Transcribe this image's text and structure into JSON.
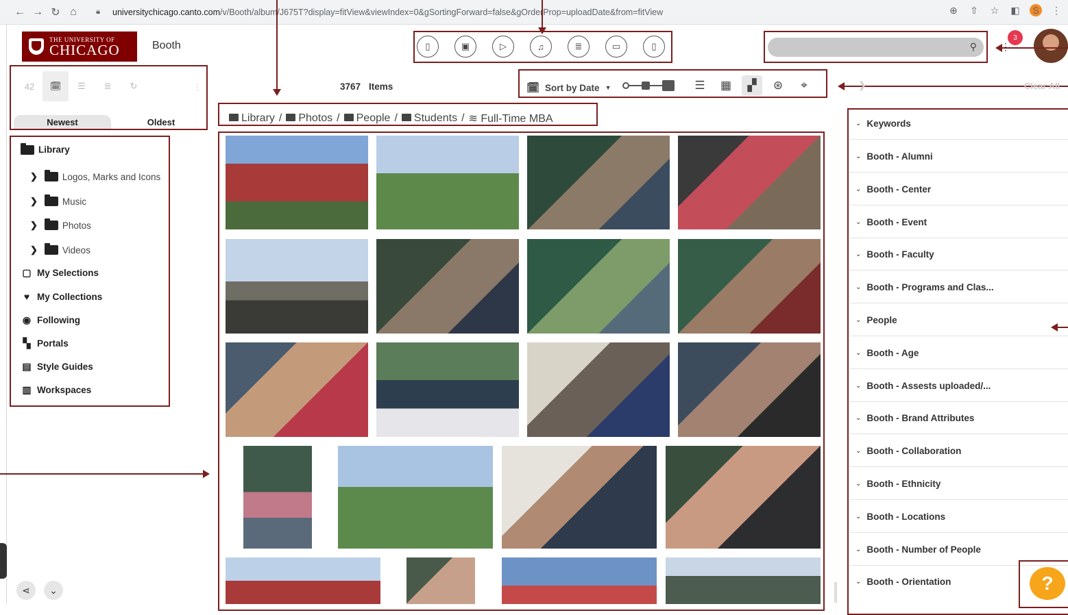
{
  "browser": {
    "url_host": "universitychicago.canto.com",
    "url_path": "/v/Booth/album/J675T?display=fitView&viewIndex=0&gSortingForward=false&gOrderProp=uploadDate&from=fitView",
    "profile_initial": "S"
  },
  "header": {
    "logo_small": "THE UNIVERSITY OF",
    "logo_big": "CHICAGO",
    "brand_label": "Booth",
    "notification_count": "3"
  },
  "sort_panel": {
    "count_label": "42",
    "newest": "Newest",
    "oldest": "Oldest"
  },
  "sidebar": {
    "library": "Library",
    "folders": [
      "Logos, Marks and Icons",
      "Music",
      "Photos",
      "Videos"
    ],
    "my_selections": "My Selections",
    "my_collections": "My Collections",
    "following": "Following",
    "portals": "Portals",
    "style_guides": "Style Guides",
    "workspaces": "Workspaces"
  },
  "toolbar": {
    "item_count": "3767",
    "items_label": "Items",
    "sort_label": "Sort by Date"
  },
  "breadcrumb": {
    "items": [
      "Library",
      "Photos",
      "People",
      "Students",
      "Full-Time MBA"
    ],
    "sep": "/"
  },
  "facets": {
    "clear_all": "Clear All",
    "items": [
      "Keywords",
      "Booth - Alumni",
      "Booth - Center",
      "Booth - Event",
      "Booth - Faculty",
      "Booth - Programs and Clas...",
      "People",
      "Booth - Age",
      "Booth - Assests uploaded/...",
      "Booth - Brand Attributes",
      "Booth - Collaboration",
      "Booth - Ethnicity",
      "Booth - Locations",
      "Booth - Number of People",
      "Booth - Orientation"
    ]
  },
  "colors": {
    "annotation": "#7b1e1e",
    "brand_maroon": "#800000",
    "help": "#f7a51a",
    "notification": "#e53950"
  },
  "help": {
    "label": "?"
  }
}
